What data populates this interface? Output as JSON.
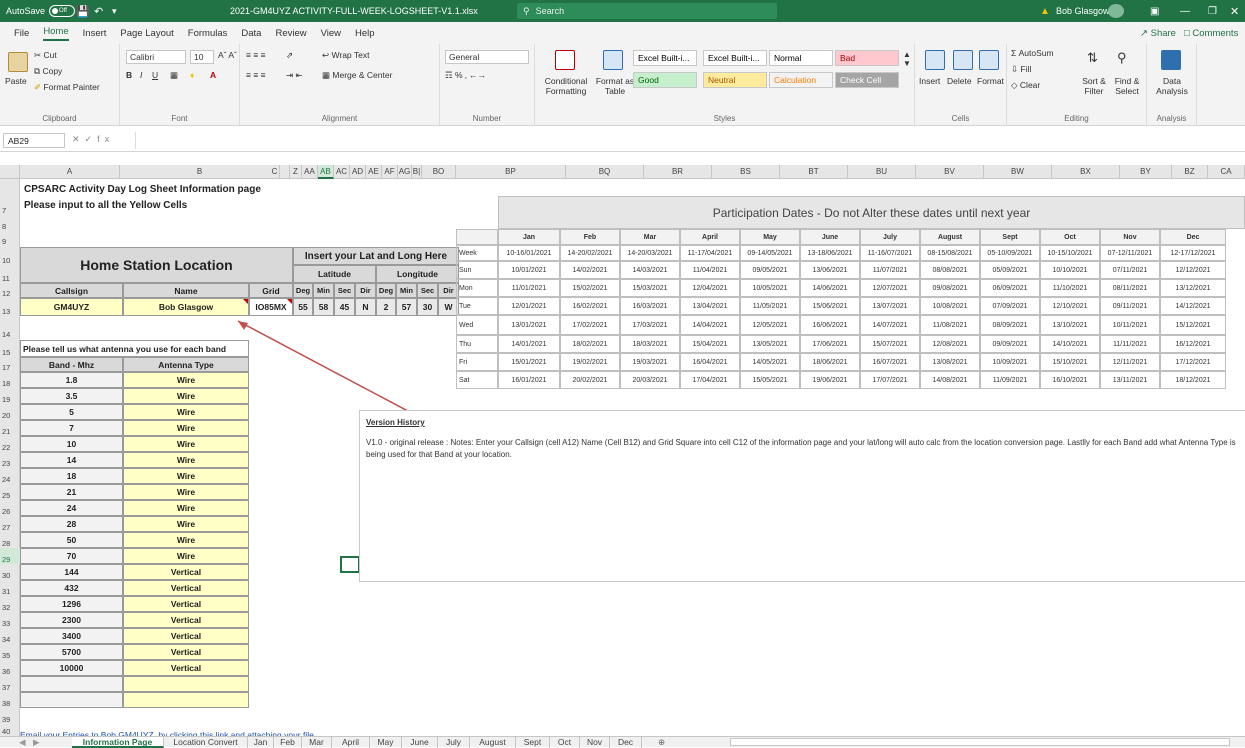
{
  "titlebar": {
    "autosave_label": "AutoSave",
    "autosave_state": "Off",
    "filename": "2021-GM4UYZ ACTIVITY-FULL-WEEK-LOGSHEET-V1.1.xlsx",
    "search_placeholder": "Search",
    "user": "Bob Glasgow",
    "warning_icon": "warning-icon",
    "accent_color": "#217346"
  },
  "menu": [
    "File",
    "Home",
    "Insert",
    "Page Layout",
    "Formulas",
    "Data",
    "Review",
    "View",
    "Help"
  ],
  "menu_active": "Home",
  "share_label": "Share",
  "comments_label": "Comments",
  "ribbon": {
    "clipboard": {
      "paste": "Paste",
      "cut": "Cut",
      "copy": "Copy",
      "format_painter": "Format Painter",
      "label": "Clipboard"
    },
    "font": {
      "name": "Calibri",
      "size": "10",
      "label": "Font"
    },
    "alignment": {
      "wrap_text": "Wrap Text",
      "merge_center": "Merge & Center",
      "label": "Alignment"
    },
    "number": {
      "format": "General",
      "label": "Number"
    },
    "styles": {
      "conditional_formatting": "Conditional Formatting",
      "format_as_table": "Format as Table",
      "cells": [
        {
          "text": "Excel Built-i...",
          "bg": "#ffffff",
          "color": "#000000"
        },
        {
          "text": "Excel Built-i...",
          "bg": "#ffffff",
          "color": "#000000"
        },
        {
          "text": "Normal",
          "bg": "#ffffff",
          "color": "#000000"
        },
        {
          "text": "Bad",
          "bg": "#ffc7ce",
          "color": "#9c0006"
        },
        {
          "text": "Good",
          "bg": "#c6efce",
          "color": "#006100"
        },
        {
          "text": "Neutral",
          "bg": "#ffeb9c",
          "color": "#9c5700"
        },
        {
          "text": "Calculation",
          "bg": "#f2f2f2",
          "color": "#fa7d00"
        },
        {
          "text": "Check Cell",
          "bg": "#a5a5a5",
          "color": "#ffffff"
        }
      ],
      "label": "Styles"
    },
    "cells": {
      "insert": "Insert",
      "delete": "Delete",
      "format": "Format",
      "label": "Cells"
    },
    "editing": {
      "autosum": "AutoSum",
      "fill": "Fill",
      "clear": "Clear",
      "sort_filter": "Sort & Filter",
      "find_select": "Find & Select",
      "label": "Editing"
    },
    "analysis": {
      "data_analysis": "Data Analysis",
      "label": "Analysis"
    }
  },
  "formula_bar": {
    "name_box": "AB29",
    "formula": ""
  },
  "column_headers": [
    "A",
    "B",
    "C",
    "Z",
    "AA",
    "AB",
    "AC",
    "AD",
    "AE",
    "AF",
    "AG",
    "B|",
    "BO",
    "BP",
    "BQ",
    "BR",
    "BS",
    "BT",
    "BU",
    "BV",
    "BW",
    "BX",
    "BY",
    "BZ",
    "CA"
  ],
  "selected_column": "AB",
  "row_numbers": [
    "",
    "7",
    "8",
    "9",
    "10",
    "11",
    "12",
    "13",
    "14",
    "15",
    "17",
    "18",
    "19",
    "20",
    "21",
    "22",
    "23",
    "24",
    "25",
    "26",
    "27",
    "28",
    "29",
    "30",
    "31",
    "32",
    "33",
    "34",
    "35",
    "36",
    "37",
    "38",
    "39",
    "40"
  ],
  "selected_row": "29",
  "sheet": {
    "title1": "CPSARC Activity Day Log Sheet Information page",
    "title2": "Please input to all the Yellow Cells",
    "home_station": "Home Station Location",
    "latlong_header": "Insert your Lat and Long Here",
    "latitude": "Latitude",
    "longitude": "Longitude",
    "col_callsign": "Callsign",
    "col_name": "Name",
    "col_grid": "Grid",
    "dms_headers": [
      "Deg",
      "Min",
      "Sec",
      "Dir",
      "Deg",
      "Min",
      "Sec",
      "Dir"
    ],
    "callsign": "GM4UYZ",
    "name": "Bob Glasgow",
    "grid": "IO85MX",
    "lat": [
      "55",
      "58",
      "45",
      "N"
    ],
    "lon": [
      "2",
      "57",
      "30",
      "W"
    ],
    "antenna_prompt": "Please tell us what antenna you use for each band",
    "band_header": "Band - Mhz",
    "antenna_header": "Antenna Type",
    "bands": [
      {
        "band": "1.8",
        "antenna": "Wire"
      },
      {
        "band": "3.5",
        "antenna": "Wire"
      },
      {
        "band": "5",
        "antenna": "Wire"
      },
      {
        "band": "7",
        "antenna": "Wire"
      },
      {
        "band": "10",
        "antenna": "Wire"
      },
      {
        "band": "14",
        "antenna": "Wire"
      },
      {
        "band": "18",
        "antenna": "Wire"
      },
      {
        "band": "21",
        "antenna": "Wire"
      },
      {
        "band": "24",
        "antenna": "Wire"
      },
      {
        "band": "28",
        "antenna": "Wire"
      },
      {
        "band": "50",
        "antenna": "Wire"
      },
      {
        "band": "70",
        "antenna": "Wire"
      },
      {
        "band": "144",
        "antenna": "Vertical"
      },
      {
        "band": "432",
        "antenna": "Vertical"
      },
      {
        "band": "1296",
        "antenna": "Vertical"
      },
      {
        "band": "2300",
        "antenna": "Vertical"
      },
      {
        "band": "3400",
        "antenna": "Vertical"
      },
      {
        "band": "5700",
        "antenna": "Vertical"
      },
      {
        "band": "10000",
        "antenna": "Vertical"
      },
      {
        "band": "",
        "antenna": ""
      },
      {
        "band": "",
        "antenna": ""
      }
    ],
    "email_link": "Email your Entries to Bob GM4UYZ, by clicking this link and attaching your file"
  },
  "participation": {
    "title": "Participation Dates - Do not Alter these dates until next year",
    "months": [
      "Jan",
      "Feb",
      "Mar",
      "April",
      "May",
      "June",
      "July",
      "August",
      "Sept",
      "Oct",
      "Nov",
      "Dec"
    ],
    "rows": [
      {
        "label": "Week",
        "values": [
          "10-16/01/2021",
          "14-20/02/2021",
          "14-20/03/2021",
          "11-17/04/2021",
          "09-14/05/2021",
          "13-18/06/2021",
          "11-16/07/2021",
          "08-15/08/2021",
          "05-10/09/2021",
          "10-15/10/2021",
          "07-12/11/2021",
          "12-17/12/2021"
        ]
      },
      {
        "label": "Sun",
        "values": [
          "10/01/2021",
          "14/02/2021",
          "14/03/2021",
          "11/04/2021",
          "09/05/2021",
          "13/06/2021",
          "11/07/2021",
          "08/08/2021",
          "05/09/2021",
          "10/10/2021",
          "07/11/2021",
          "12/12/2021"
        ]
      },
      {
        "label": "Mon",
        "values": [
          "11/01/2021",
          "15/02/2021",
          "15/03/2021",
          "12/04/2021",
          "10/05/2021",
          "14/06/2021",
          "12/07/2021",
          "09/08/2021",
          "06/09/2021",
          "11/10/2021",
          "08/11/2021",
          "13/12/2021"
        ]
      },
      {
        "label": "Tue",
        "values": [
          "12/01/2021",
          "16/02/2021",
          "16/03/2021",
          "13/04/2021",
          "11/05/2021",
          "15/06/2021",
          "13/07/2021",
          "10/08/2021",
          "07/09/2021",
          "12/10/2021",
          "09/11/2021",
          "14/12/2021"
        ]
      },
      {
        "label": "Wed",
        "values": [
          "13/01/2021",
          "17/02/2021",
          "17/03/2021",
          "14/04/2021",
          "12/05/2021",
          "16/06/2021",
          "14/07/2021",
          "11/08/2021",
          "08/09/2021",
          "13/10/2021",
          "10/11/2021",
          "15/12/2021"
        ]
      },
      {
        "label": "Thu",
        "values": [
          "14/01/2021",
          "18/02/2021",
          "18/03/2021",
          "15/04/2021",
          "13/05/2021",
          "17/06/2021",
          "15/07/2021",
          "12/08/2021",
          "09/09/2021",
          "14/10/2021",
          "11/11/2021",
          "16/12/2021"
        ]
      },
      {
        "label": "Fri",
        "values": [
          "15/01/2021",
          "19/02/2021",
          "19/03/2021",
          "16/04/2021",
          "14/05/2021",
          "18/06/2021",
          "16/07/2021",
          "13/08/2021",
          "10/09/2021",
          "15/10/2021",
          "12/11/2021",
          "17/12/2021"
        ]
      },
      {
        "label": "Sat",
        "values": [
          "16/01/2021",
          "20/02/2021",
          "20/03/2021",
          "17/04/2021",
          "15/05/2021",
          "19/06/2021",
          "17/07/2021",
          "14/08/2021",
          "11/09/2021",
          "16/10/2021",
          "13/11/2021",
          "18/12/2021"
        ]
      }
    ]
  },
  "version_history": {
    "title": "Version History",
    "text": "V1.0 - original release : Notes: Enter your Callsign (cell A12) Name (Cell B12) and Grid Square into cell C12 of the information page and your lat/long will auto calc from the location conversion page. Lastlly for each Band add what Antenna Type is being used for that Band at your location."
  },
  "sheet_tabs": [
    "Information Page",
    "Location Convert",
    "Jan",
    "Feb",
    "Mar",
    "April",
    "May",
    "June",
    "July",
    "August",
    "Sept",
    "Oct",
    "Nov",
    "Dec"
  ],
  "active_tab": "Information Page"
}
